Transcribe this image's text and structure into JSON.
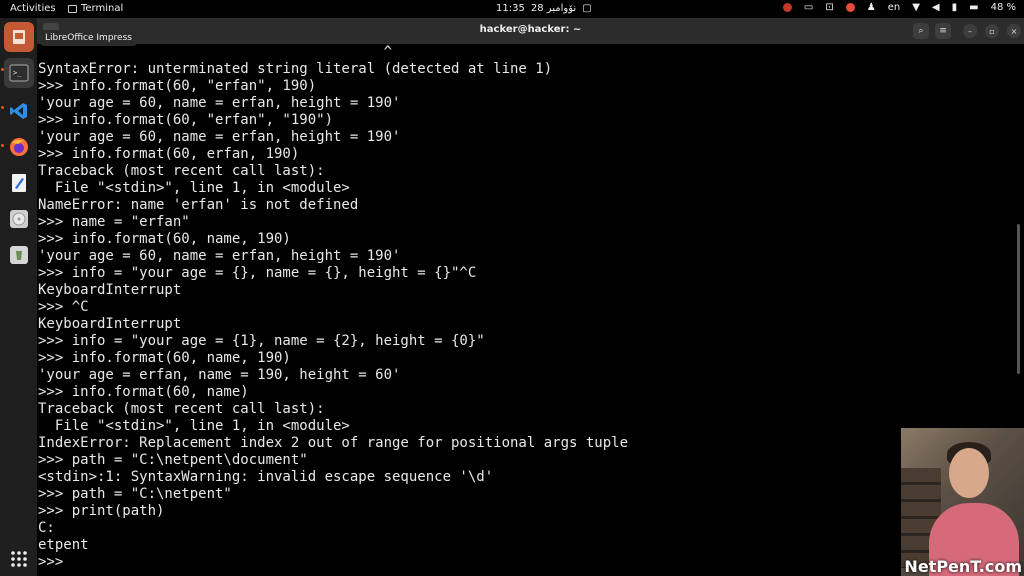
{
  "topbar": {
    "activities": "Activities",
    "app_name": "Terminal",
    "time": "11:35",
    "date": "28 نۆوامبر",
    "lang": "en",
    "battery": "48 %"
  },
  "tooltip": "LibreOffice Impress",
  "window": {
    "title": "hacker@hacker: ~"
  },
  "terminal": {
    "lines": [
      "                                         ^",
      "SyntaxError: unterminated string literal (detected at line 1)",
      ">>> info.format(60, \"erfan\", 190)",
      "'your age = 60, name = erfan, height = 190'",
      ">>> info.format(60, \"erfan\", \"190\")",
      "'your age = 60, name = erfan, height = 190'",
      ">>> info.format(60, erfan, 190)",
      "Traceback (most recent call last):",
      "  File \"<stdin>\", line 1, in <module>",
      "NameError: name 'erfan' is not defined",
      ">>> name = \"erfan\"",
      ">>> info.format(60, name, 190)",
      "'your age = 60, name = erfan, height = 190'",
      ">>> info = \"your age = {}, name = {}, height = {}\"^C",
      "KeyboardInterrupt",
      ">>> ^C",
      "KeyboardInterrupt",
      ">>> info = \"your age = {1}, name = {2}, height = {0}\"",
      ">>> info.format(60, name, 190)",
      "'your age = erfan, name = 190, height = 60'",
      ">>> info.format(60, name)",
      "Traceback (most recent call last):",
      "  File \"<stdin>\", line 1, in <module>",
      "IndexError: Replacement index 2 out of range for positional args tuple",
      ">>> path = \"C:\\netpent\\document\"",
      "<stdin>:1: SyntaxWarning: invalid escape sequence '\\d'",
      ">>> path = \"C:\\netpent\"",
      ">>> print(path)",
      "C:",
      "etpent",
      ">>> "
    ]
  },
  "webcam": {
    "brand": "NetPenT.com"
  }
}
